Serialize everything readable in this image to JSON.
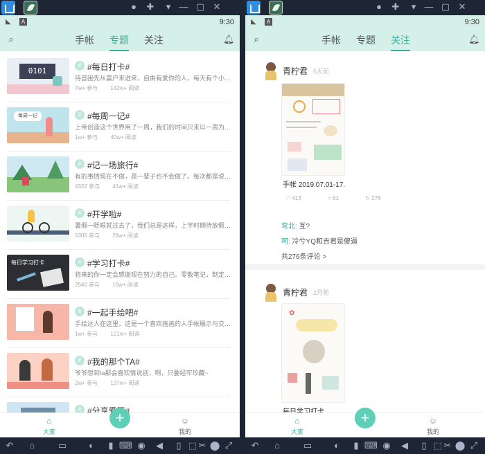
{
  "left": {
    "status_time": "9:30",
    "tabs": [
      "手帐",
      "专题",
      "关注"
    ],
    "active_tab": 1,
    "topics": [
      {
        "title": "#每日打卡#",
        "desc": "待首困先从晨户来进来，自由有爱你的人，每天有个小坚持，",
        "members": "7w+ 参与",
        "views": "142w+ 阅读"
      },
      {
        "title": "#每周一记#",
        "desc": "上帝创造这个世界用了一周，我们的时间只来以一周为单位搜搜",
        "members": "1w+ 参与",
        "views": "40w+ 阅读"
      },
      {
        "title": "#记一场旅行#",
        "desc": "有的事情现在不做，是一辈子也不会做了。每次都是说到就走的",
        "members": "4322 参与",
        "views": "41w+ 阅读"
      },
      {
        "title": "#开学啦#",
        "desc": "暑假一眨眼就过去了，我们总是这样，上学时期待放假，放",
        "members": "5305 参与",
        "views": "28w+ 阅读"
      },
      {
        "title": "#学习打卡#",
        "desc": "将来的你一定会感谢现在努力的自己。零散笔记，制定学习目",
        "members": "2540 参与",
        "views": "16w+ 阅读"
      },
      {
        "title": "#一起手绘吧#",
        "desc": "手绘达人在这里，这是一个喜欢画画的人手帐展示与交流荣地",
        "members": "1w+ 参与",
        "views": "121w+ 阅读"
      },
      {
        "title": "#我的那个TA#",
        "desc": "爷爷想到ta那会喜欢情说别，啊，只要经牢珍藏~",
        "members": "2w+ 参与",
        "views": "137w+ 阅读"
      },
      {
        "title": "#分享爱豆#",
        "desc": "",
        "members": "",
        "views": ""
      }
    ],
    "nav": {
      "home": "大家",
      "profile": "我的",
      "fab": "+"
    }
  },
  "right": {
    "status_time": "9:30",
    "tabs": [
      "手帐",
      "专题",
      "关注"
    ],
    "active_tab": 2,
    "posts": [
      {
        "user": "青柠君",
        "time": "6天前",
        "caption": "手帐 2019.07.01-17...",
        "likes": "413",
        "comments": "61",
        "shares": "276",
        "comment_list": [
          {
            "who": "弯北:",
            "text": "互?"
          },
          {
            "who": "呵:",
            "text": "冷兮YQ和吉君是傻逼"
          }
        ],
        "more": "共276条评论 >"
      },
      {
        "user": "青柠君",
        "time": "2月前",
        "caption": "每日学习打卡",
        "likes": "",
        "comments": "",
        "shares": "",
        "comment_list": [],
        "more": ""
      }
    ],
    "nav": {
      "home": "大家",
      "profile": "我的",
      "fab": "+"
    }
  },
  "colors": {
    "accent": "#3ab09a",
    "header_bg": "#d5f0e8",
    "fab": "#5fd0b7"
  },
  "icons": {
    "search": "search-icon",
    "bell": "bell-icon",
    "home": "home-icon",
    "profile": "profile-icon",
    "add": "plus-icon",
    "like": "heart-icon",
    "comment": "comment-icon",
    "share": "share-icon"
  }
}
